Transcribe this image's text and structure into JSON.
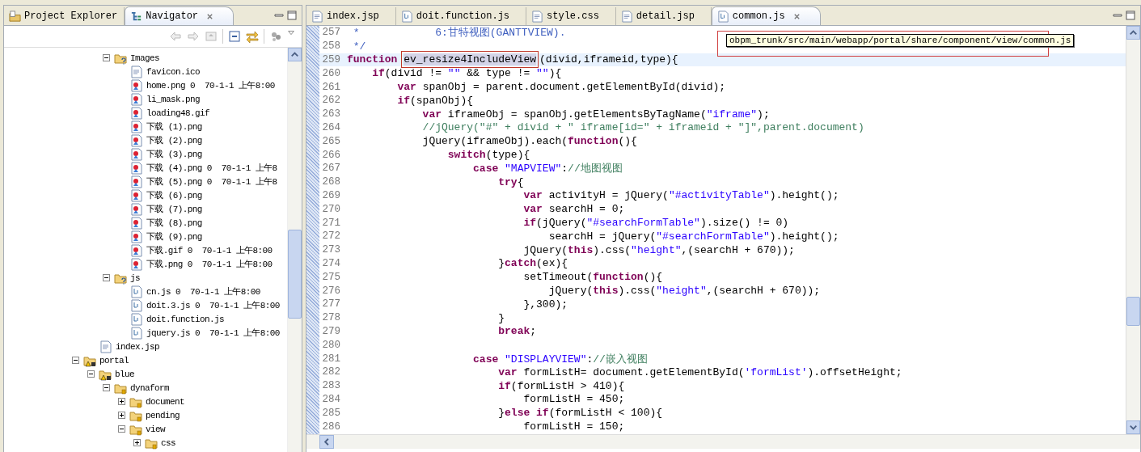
{
  "left_panel": {
    "tabs": [
      {
        "label": "Project Explorer",
        "kind": "explorer",
        "selected": false
      },
      {
        "label": "Navigator",
        "kind": "navigator",
        "selected": true
      }
    ],
    "tree": [
      {
        "children": [
          {
            "children": [
              {
                "label": "Images",
                "kind": "folder-unknown",
                "expanded": true,
                "children": [
                  {
                    "label": "favicon.ico",
                    "kind": "text"
                  },
                  {
                    "label": "home.png 0  70-1-1 上午8:00",
                    "kind": "image"
                  },
                  {
                    "label": "li_mask.png",
                    "kind": "image"
                  },
                  {
                    "label": "loading48.gif",
                    "kind": "image"
                  },
                  {
                    "label": "下载 (1).png",
                    "kind": "image"
                  },
                  {
                    "label": "下载 (2).png",
                    "kind": "image"
                  },
                  {
                    "label": "下载 (3).png",
                    "kind": "image"
                  },
                  {
                    "label": "下载 (4).png 0  70-1-1 上午8",
                    "kind": "image"
                  },
                  {
                    "label": "下载 (5).png 0  70-1-1 上午8",
                    "kind": "image"
                  },
                  {
                    "label": "下载 (6).png",
                    "kind": "image"
                  },
                  {
                    "label": "下载 (7).png",
                    "kind": "image"
                  },
                  {
                    "label": "下载 (8).png",
                    "kind": "image"
                  },
                  {
                    "label": "下载 (9).png",
                    "kind": "image"
                  },
                  {
                    "label": "下载.gif 0  70-1-1 上午8:00",
                    "kind": "image"
                  },
                  {
                    "label": "下载.png 0  70-1-1 上午8:00",
                    "kind": "image"
                  }
                ]
              },
              {
                "label": "js",
                "kind": "folder-unknown",
                "expanded": true,
                "children": [
                  {
                    "label": "cn.js 0  70-1-1 上午8:00",
                    "kind": "script"
                  },
                  {
                    "label": "doit.3.js 0  70-1-1 上午8:00",
                    "kind": "script"
                  },
                  {
                    "label": "doit.function.js",
                    "kind": "script"
                  },
                  {
                    "label": "jquery.js 0  70-1-1 上午8:00",
                    "kind": "script"
                  }
                ]
              }
            ]
          },
          {
            "label": "index.jsp",
            "kind": "text"
          }
        ]
      },
      {
        "label": "portal",
        "kind": "folder-warning",
        "expanded": true,
        "children": [
          {
            "label": "blue",
            "kind": "folder-warning",
            "expanded": true,
            "children": [
              {
                "label": "dynaform",
                "kind": "folder",
                "expanded": true,
                "children": [
                  {
                    "label": "document",
                    "kind": "folder",
                    "expanded": false
                  },
                  {
                    "label": "pending",
                    "kind": "folder",
                    "expanded": false
                  },
                  {
                    "label": "view",
                    "kind": "folder",
                    "expanded": true,
                    "children": [
                      {
                        "label": "css",
                        "kind": "folder",
                        "expanded": false
                      }
                    ]
                  }
                ]
              }
            ]
          }
        ]
      }
    ]
  },
  "editor": {
    "tabs": [
      {
        "label": "index.jsp",
        "kind": "text",
        "selected": false
      },
      {
        "label": "doit.function.js",
        "kind": "script",
        "selected": false
      },
      {
        "label": "style.css",
        "kind": "text",
        "selected": false
      },
      {
        "label": "detail.jsp",
        "kind": "text",
        "selected": false
      },
      {
        "label": "common.js",
        "kind": "script",
        "selected": true
      }
    ],
    "tooltip": "obpm_trunk/src/main/webapp/portal/share/component/view/common.js",
    "lines": [
      {
        "number": "257",
        "current": false,
        "tokens": [
          {
            "kind": "doc",
            "text": " *            6:甘特视图(GANTTVIEW)."
          }
        ]
      },
      {
        "number": "258",
        "current": false,
        "tokens": [
          {
            "kind": "doc",
            "text": " */"
          }
        ]
      },
      {
        "number": "259",
        "current": true,
        "tokens": [
          {
            "kind": "kw",
            "text": "function "
          },
          {
            "kind": "mark",
            "text": "ev_resize4IncludeView"
          },
          {
            "kind": "plain",
            "text": "(divid,iframeid,type){"
          }
        ]
      },
      {
        "number": "260",
        "current": false,
        "tokens": [
          {
            "kind": "kw",
            "text": "    if"
          },
          {
            "kind": "plain",
            "text": "(divid != "
          },
          {
            "kind": "str",
            "text": "\"\""
          },
          {
            "kind": "plain",
            "text": " && type != "
          },
          {
            "kind": "str",
            "text": "\"\""
          },
          {
            "kind": "plain",
            "text": "){"
          }
        ]
      },
      {
        "number": "261",
        "current": false,
        "tokens": [
          {
            "kind": "kw",
            "text": "        var"
          },
          {
            "kind": "plain",
            "text": " spanObj = parent.document.getElementById(divid);"
          }
        ]
      },
      {
        "number": "262",
        "current": false,
        "tokens": [
          {
            "kind": "kw",
            "text": "        if"
          },
          {
            "kind": "plain",
            "text": "(spanObj){"
          }
        ]
      },
      {
        "number": "263",
        "current": false,
        "tokens": [
          {
            "kind": "kw",
            "text": "            var"
          },
          {
            "kind": "plain",
            "text": " iframeObj = spanObj.getElementsByTagName("
          },
          {
            "kind": "str",
            "text": "\"iframe\""
          },
          {
            "kind": "plain",
            "text": ");"
          }
        ]
      },
      {
        "number": "264",
        "current": false,
        "tokens": [
          {
            "kind": "cm",
            "text": "            //jQuery(\"#\" + divid + \" iframe[id=\" + iframeid + \"]\",parent.document)"
          }
        ]
      },
      {
        "number": "265",
        "current": false,
        "tokens": [
          {
            "kind": "plain",
            "text": "            jQuery(iframeObj).each("
          },
          {
            "kind": "kw",
            "text": "function"
          },
          {
            "kind": "plain",
            "text": "(){"
          }
        ]
      },
      {
        "number": "266",
        "current": false,
        "tokens": [
          {
            "kind": "kw",
            "text": "                switch"
          },
          {
            "kind": "plain",
            "text": "(type){"
          }
        ]
      },
      {
        "number": "267",
        "current": false,
        "tokens": [
          {
            "kind": "kw",
            "text": "                    case "
          },
          {
            "kind": "str",
            "text": "\"MAPVIEW\""
          },
          {
            "kind": "plain",
            "text": ":"
          },
          {
            "kind": "cm",
            "text": "//地图视图"
          }
        ]
      },
      {
        "number": "268",
        "current": false,
        "tokens": [
          {
            "kind": "kw",
            "text": "                        try"
          },
          {
            "kind": "plain",
            "text": "{"
          }
        ]
      },
      {
        "number": "269",
        "current": false,
        "tokens": [
          {
            "kind": "kw",
            "text": "                            var"
          },
          {
            "kind": "plain",
            "text": " activityH = jQuery("
          },
          {
            "kind": "str",
            "text": "\"#activityTable\""
          },
          {
            "kind": "plain",
            "text": ").height();"
          }
        ]
      },
      {
        "number": "270",
        "current": false,
        "tokens": [
          {
            "kind": "kw",
            "text": "                            var"
          },
          {
            "kind": "plain",
            "text": " searchH = 0;"
          }
        ]
      },
      {
        "number": "271",
        "current": false,
        "tokens": [
          {
            "kind": "kw",
            "text": "                            if"
          },
          {
            "kind": "plain",
            "text": "(jQuery("
          },
          {
            "kind": "str",
            "text": "\"#searchFormTable\""
          },
          {
            "kind": "plain",
            "text": ").size() != 0)"
          }
        ]
      },
      {
        "number": "272",
        "current": false,
        "tokens": [
          {
            "kind": "plain",
            "text": "                                searchH = jQuery("
          },
          {
            "kind": "str",
            "text": "\"#searchFormTable\""
          },
          {
            "kind": "plain",
            "text": ").height();"
          }
        ]
      },
      {
        "number": "273",
        "current": false,
        "tokens": [
          {
            "kind": "plain",
            "text": "                            jQuery("
          },
          {
            "kind": "kw",
            "text": "this"
          },
          {
            "kind": "plain",
            "text": ").css("
          },
          {
            "kind": "str",
            "text": "\"height\""
          },
          {
            "kind": "plain",
            "text": ",(searchH + 670));"
          }
        ]
      },
      {
        "number": "274",
        "current": false,
        "tokens": [
          {
            "kind": "plain",
            "text": "                        }"
          },
          {
            "kind": "kw",
            "text": "catch"
          },
          {
            "kind": "plain",
            "text": "(ex){"
          }
        ]
      },
      {
        "number": "275",
        "current": false,
        "tokens": [
          {
            "kind": "plain",
            "text": "                            setTimeout("
          },
          {
            "kind": "kw",
            "text": "function"
          },
          {
            "kind": "plain",
            "text": "(){"
          }
        ]
      },
      {
        "number": "276",
        "current": false,
        "tokens": [
          {
            "kind": "plain",
            "text": "                                jQuery("
          },
          {
            "kind": "kw",
            "text": "this"
          },
          {
            "kind": "plain",
            "text": ").css("
          },
          {
            "kind": "str",
            "text": "\"height\""
          },
          {
            "kind": "plain",
            "text": ",(searchH + 670));"
          }
        ]
      },
      {
        "number": "277",
        "current": false,
        "tokens": [
          {
            "kind": "plain",
            "text": "                            },300);"
          }
        ]
      },
      {
        "number": "278",
        "current": false,
        "tokens": [
          {
            "kind": "plain",
            "text": "                        }"
          }
        ]
      },
      {
        "number": "279",
        "current": false,
        "tokens": [
          {
            "kind": "kw",
            "text": "                        break"
          },
          {
            "kind": "plain",
            "text": ";"
          }
        ]
      },
      {
        "number": "280",
        "current": false
      },
      {
        "number": "281",
        "current": false,
        "tokens": [
          {
            "kind": "kw",
            "text": "                    case "
          },
          {
            "kind": "str",
            "text": "\"DISPLAYVIEW\""
          },
          {
            "kind": "plain",
            "text": ":"
          },
          {
            "kind": "cm",
            "text": "//嵌入视图"
          }
        ]
      },
      {
        "number": "282",
        "current": false,
        "tokens": [
          {
            "kind": "kw",
            "text": "                        var"
          },
          {
            "kind": "plain",
            "text": " formListH= document.getElementById("
          },
          {
            "kind": "str",
            "text": "'formList'"
          },
          {
            "kind": "plain",
            "text": ").offsetHeight;"
          }
        ]
      },
      {
        "number": "283",
        "current": false,
        "tokens": [
          {
            "kind": "kw",
            "text": "                        if"
          },
          {
            "kind": "plain",
            "text": "(formListH > 410){"
          }
        ]
      },
      {
        "number": "284",
        "current": false,
        "tokens": [
          {
            "kind": "plain",
            "text": "                            formListH = 450;"
          }
        ]
      },
      {
        "number": "285",
        "current": false,
        "tokens": [
          {
            "kind": "plain",
            "text": "                        }"
          },
          {
            "kind": "kw",
            "text": "else if"
          },
          {
            "kind": "plain",
            "text": "(formListH < 100){"
          }
        ]
      },
      {
        "number": "286",
        "current": false,
        "tokens": [
          {
            "kind": "plain",
            "text": "                            formListH = 150;"
          }
        ]
      }
    ]
  }
}
